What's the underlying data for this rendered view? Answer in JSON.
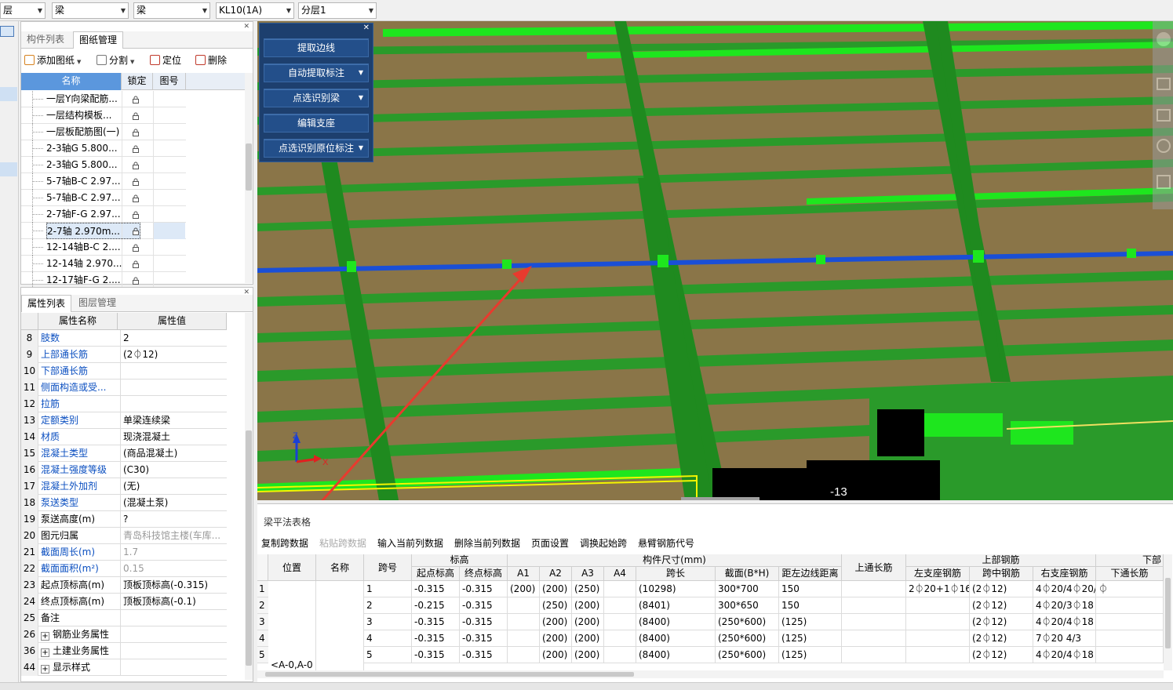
{
  "topbar": {
    "floor": "层",
    "component_type": "梁",
    "component_subtype": "梁",
    "component_name": "KL10(1A)",
    "layer": "分层1"
  },
  "panelA": {
    "tabs": [
      "构件列表",
      "图纸管理"
    ],
    "toolbar": {
      "add": "添加图纸",
      "split": "分割",
      "locate": "定位",
      "delete": "删除"
    },
    "columns": {
      "name": "名称",
      "lock": "锁定",
      "num": "图号"
    },
    "rows": [
      "一层Y向梁配筋...",
      "一层结构模板...",
      "一层板配筋图(一)",
      "2-3轴G 5.800...",
      "2-3轴G 5.800...",
      "5-7轴B-C 2.97...",
      "5-7轴B-C 2.97...",
      "2-7轴F-G 2.97...",
      "2-7轴 2.970m...",
      "12-14轴B-C 2....",
      "12-14轴 2.970...",
      "12-17轴F-G 2...."
    ]
  },
  "panelB": {
    "tabs": [
      "属性列表",
      "图层管理"
    ],
    "columns": {
      "name": "属性名称",
      "value": "属性值"
    },
    "rows": [
      {
        "no": "8",
        "name": "肢数",
        "value": "2"
      },
      {
        "no": "9",
        "name": "上部通长筋",
        "value": "(2⏀12)"
      },
      {
        "no": "10",
        "name": "下部通长筋",
        "value": ""
      },
      {
        "no": "11",
        "name": "侧面构造或受...",
        "value": ""
      },
      {
        "no": "12",
        "name": "拉筋",
        "value": ""
      },
      {
        "no": "13",
        "name": "定额类别",
        "value": "单梁连续梁"
      },
      {
        "no": "14",
        "name": "材质",
        "value": "现浇混凝土"
      },
      {
        "no": "15",
        "name": "混凝土类型",
        "value": "(商品混凝土)"
      },
      {
        "no": "16",
        "name": "混凝土强度等级",
        "value": "(C30)"
      },
      {
        "no": "17",
        "name": "混凝土外加剂",
        "value": "(无)"
      },
      {
        "no": "18",
        "name": "泵送类型",
        "value": "(混凝土泵)"
      },
      {
        "no": "19",
        "name": "泵送高度(m)",
        "value": "?"
      },
      {
        "no": "20",
        "name": "图元归属",
        "value": "青岛科技馆主楼(车库..."
      },
      {
        "no": "21",
        "name": "截面周长(m)",
        "value": "1.7"
      },
      {
        "no": "22",
        "name": "截面面积(m²)",
        "value": "0.15"
      },
      {
        "no": "23",
        "name": "起点顶标高(m)",
        "value": "顶板顶标高(-0.315)"
      },
      {
        "no": "24",
        "name": "终点顶标高(m)",
        "value": "顶板顶标高(-0.1)"
      },
      {
        "no": "25",
        "name": "备注",
        "value": ""
      },
      {
        "no": "26",
        "name": "钢筋业务属性",
        "value": ""
      },
      {
        "no": "36",
        "name": "土建业务属性",
        "value": ""
      },
      {
        "no": "44",
        "name": "显示样式",
        "value": ""
      }
    ]
  },
  "floatmenu": {
    "items": [
      "提取边线",
      "自动提取标注",
      "点选识别梁",
      "编辑支座",
      "点选识别原位标注"
    ]
  },
  "view3d": {
    "axis_z": "Z",
    "axis_x": "X",
    "label": "-13"
  },
  "table": {
    "title": "梁平法表格",
    "toolbar": [
      "复制跨数据",
      "粘贴跨数据",
      "输入当前列数据",
      "删除当前列数据",
      "页面设置",
      "调换起始跨",
      "悬臂钢筋代号"
    ],
    "headers": {
      "pos": "位置",
      "name": "名称",
      "span": "跨号",
      "elev": "标高",
      "start": "起点标高",
      "end": "终点标高",
      "dims": "构件尺寸(mm)",
      "a1": "A1",
      "a2": "A2",
      "a3": "A3",
      "a4": "A4",
      "len": "跨长",
      "sect": "截面(B*H)",
      "dist": "距左边线距离",
      "top_cont": "上通长筋",
      "top_bar": "上部钢筋",
      "left_sup": "左支座钢筋",
      "mid": "跨中钢筋",
      "right_sup": "右支座钢筋",
      "bot_cont": "下通长筋",
      "bot": "下部"
    },
    "position": "<A-0,A-0",
    "rows": [
      {
        "n": "1",
        "span": "1",
        "start": "-0.315",
        "end": "-0.315",
        "a1": "(200)",
        "a2": "(200)",
        "a3": "(250)",
        "len": "(10298)",
        "sect": "300*700",
        "dist": "150",
        "left": "2⏀20+1⏀16",
        "mid": "(2⏀12)",
        "right": "4⏀20/4⏀20/",
        "bot": "⏀"
      },
      {
        "n": "2",
        "span": "2",
        "start": "-0.215",
        "end": "-0.315",
        "a1": "",
        "a2": "(250)",
        "a3": "(200)",
        "len": "(8401)",
        "sect": "300*650",
        "dist": "150",
        "left": "",
        "mid": "(2⏀12)",
        "right": "4⏀20/3⏀18",
        "bot": ""
      },
      {
        "n": "3",
        "span": "3",
        "start": "-0.315",
        "end": "-0.315",
        "a1": "",
        "a2": "(200)",
        "a3": "(200)",
        "len": "(8400)",
        "sect": "(250*600)",
        "dist": "(125)",
        "left": "",
        "mid": "(2⏀12)",
        "right": "4⏀20/4⏀18",
        "bot": ""
      },
      {
        "n": "4",
        "span": "4",
        "start": "-0.315",
        "end": "-0.315",
        "a1": "",
        "a2": "(200)",
        "a3": "(200)",
        "len": "(8400)",
        "sect": "(250*600)",
        "dist": "(125)",
        "left": "",
        "mid": "(2⏀12)",
        "right": "7⏀20 4/3",
        "bot": ""
      },
      {
        "n": "5",
        "span": "5",
        "start": "-0.315",
        "end": "-0.315",
        "a1": "",
        "a2": "(200)",
        "a3": "(200)",
        "len": "(8400)",
        "sect": "(250*600)",
        "dist": "(125)",
        "left": "",
        "mid": "(2⏀12)",
        "right": "4⏀20/4⏀18",
        "bot": ""
      }
    ]
  },
  "colors": {
    "beam_green": "#1f8a1f",
    "bright_green": "#1ee61e",
    "slab_brown": "#8a7548",
    "selected_beam": "#1a4fd6",
    "menu_bg": "#1d3f6e",
    "link_blue": "#0b4fc0",
    "arrow_red": "#e83a2e"
  }
}
